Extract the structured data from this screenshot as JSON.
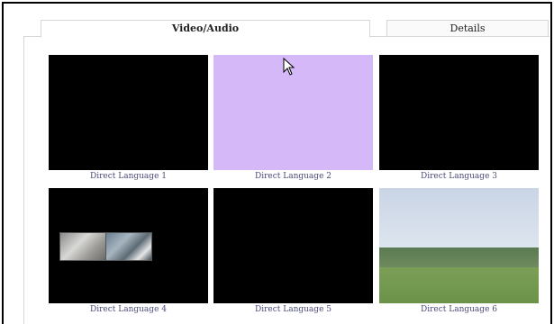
{
  "tabs": [
    {
      "label": "Video/Audio",
      "active": true
    },
    {
      "label": "Details",
      "active": false
    }
  ],
  "videos": [
    {
      "caption": "Direct Language 1",
      "fill": "#000000"
    },
    {
      "caption": "Direct Language 2",
      "fill": "#d5b8f7"
    },
    {
      "caption": "Direct Language 3",
      "fill": "#000000"
    },
    {
      "caption": "Direct Language 4",
      "fill": "#000000"
    },
    {
      "caption": "Direct Language 5",
      "fill": "#000000"
    },
    {
      "caption": "Direct Language 6",
      "fill": "#c9d4e6"
    }
  ],
  "icons": {
    "cursor": "mouse-pointer-icon"
  }
}
